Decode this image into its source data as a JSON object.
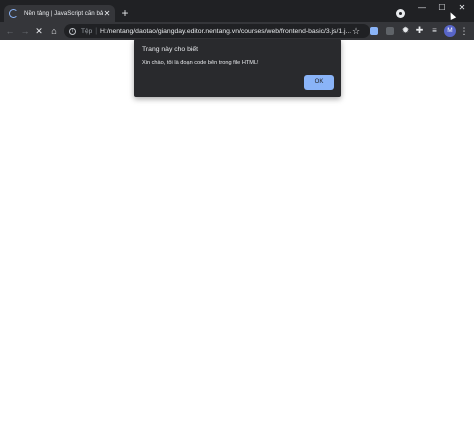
{
  "tab": {
    "title": "Nền tảng | JavaScript căn bản",
    "close_glyph": "✕",
    "loading": true
  },
  "new_tab_glyph": "+",
  "window_controls": {
    "minimize": "—",
    "maximize": "☐",
    "close": "✕"
  },
  "toolbar": {
    "back_glyph": "←",
    "forward_glyph": "→",
    "stop_glyph": "✕",
    "home_glyph": "⌂",
    "star_glyph": "☆"
  },
  "omnibox": {
    "scheme_label": "Tệp",
    "separator": "|",
    "url": "H:/nentang/daotao/giangday.editor.nentang.vn/courses/web/frontend-basic/3.js/1.j..."
  },
  "extensions": {
    "gear_glyph": "✹",
    "puzzle_glyph": "✚",
    "queue_glyph": "≡"
  },
  "profile": {
    "initial": "M",
    "color": "#5865c8"
  },
  "menu_glyph": "⋮",
  "dialog": {
    "title": "Trang này cho biết",
    "message": "Xin chào, tôi là đoạn code bên trong file HTML!",
    "ok_label": "OK",
    "accent": "#8ab4f8"
  },
  "theme": {
    "frame": "#202124",
    "toolbar": "#35363a",
    "dialog": "#292a2d"
  }
}
